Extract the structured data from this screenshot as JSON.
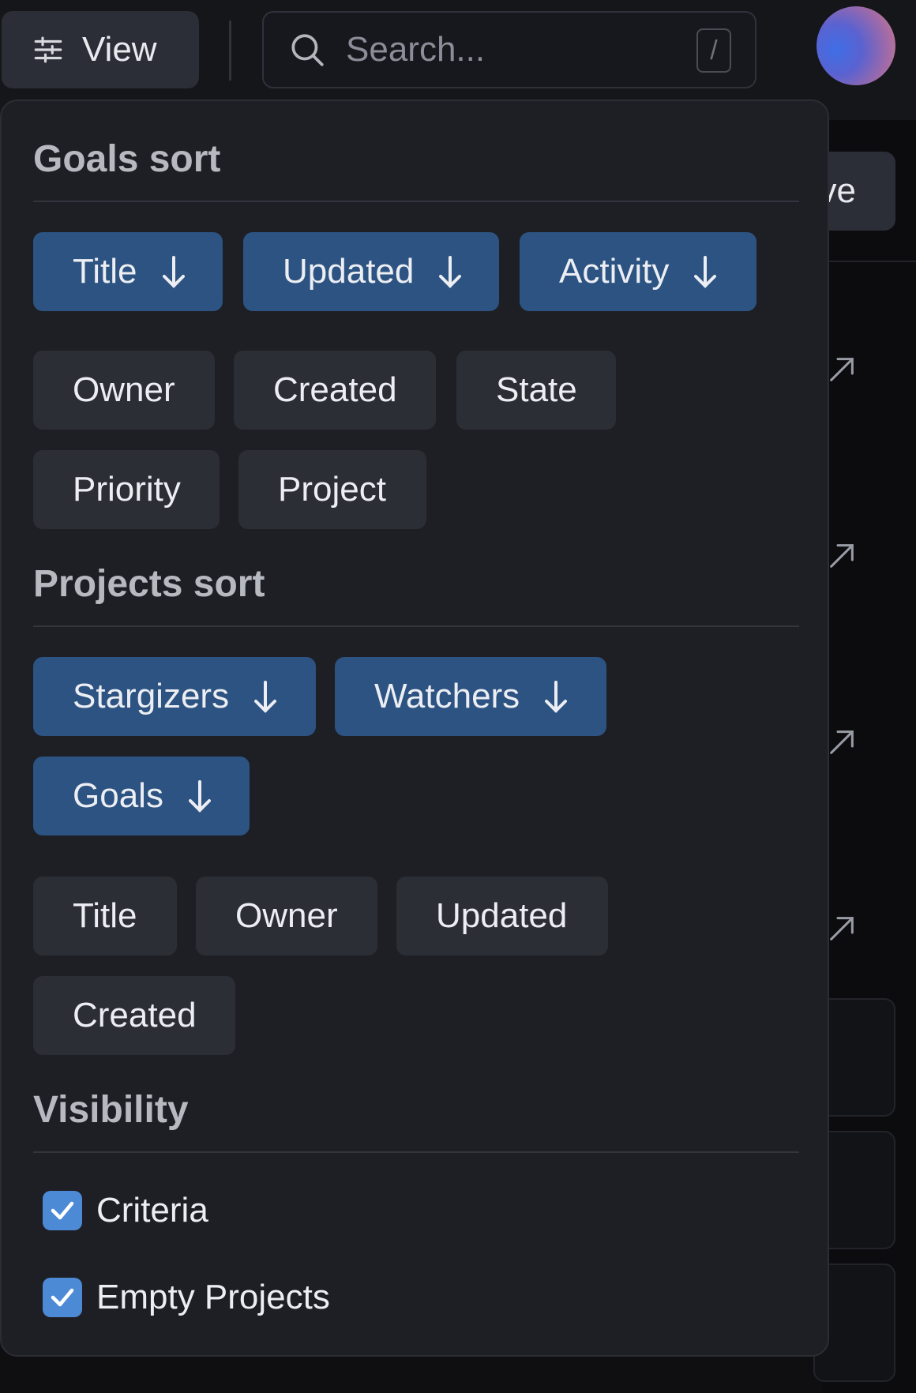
{
  "topbar": {
    "view_label": "View",
    "search_placeholder": "Search...",
    "search_shortcut": "/"
  },
  "background": {
    "button_partial_label": "ve"
  },
  "goals_sort": {
    "title": "Goals sort",
    "active": [
      {
        "label": "Title"
      },
      {
        "label": "Updated"
      },
      {
        "label": "Activity"
      }
    ],
    "inactive": [
      {
        "label": "Owner"
      },
      {
        "label": "Created"
      },
      {
        "label": "State"
      },
      {
        "label": "Priority"
      },
      {
        "label": "Project"
      }
    ]
  },
  "projects_sort": {
    "title": "Projects sort",
    "active": [
      {
        "label": "Stargizers"
      },
      {
        "label": "Watchers"
      },
      {
        "label": "Goals"
      }
    ],
    "inactive": [
      {
        "label": "Title"
      },
      {
        "label": "Owner"
      },
      {
        "label": "Updated"
      },
      {
        "label": "Created"
      }
    ]
  },
  "visibility": {
    "title": "Visibility",
    "options": [
      {
        "label": "Criteria",
        "checked": true
      },
      {
        "label": "Empty Projects",
        "checked": true
      }
    ]
  },
  "colors": {
    "active_chip": "#2c5382",
    "inactive_chip": "#2c2e35",
    "checkbox": "#4d8ad6",
    "panel": "#1e1f25"
  }
}
